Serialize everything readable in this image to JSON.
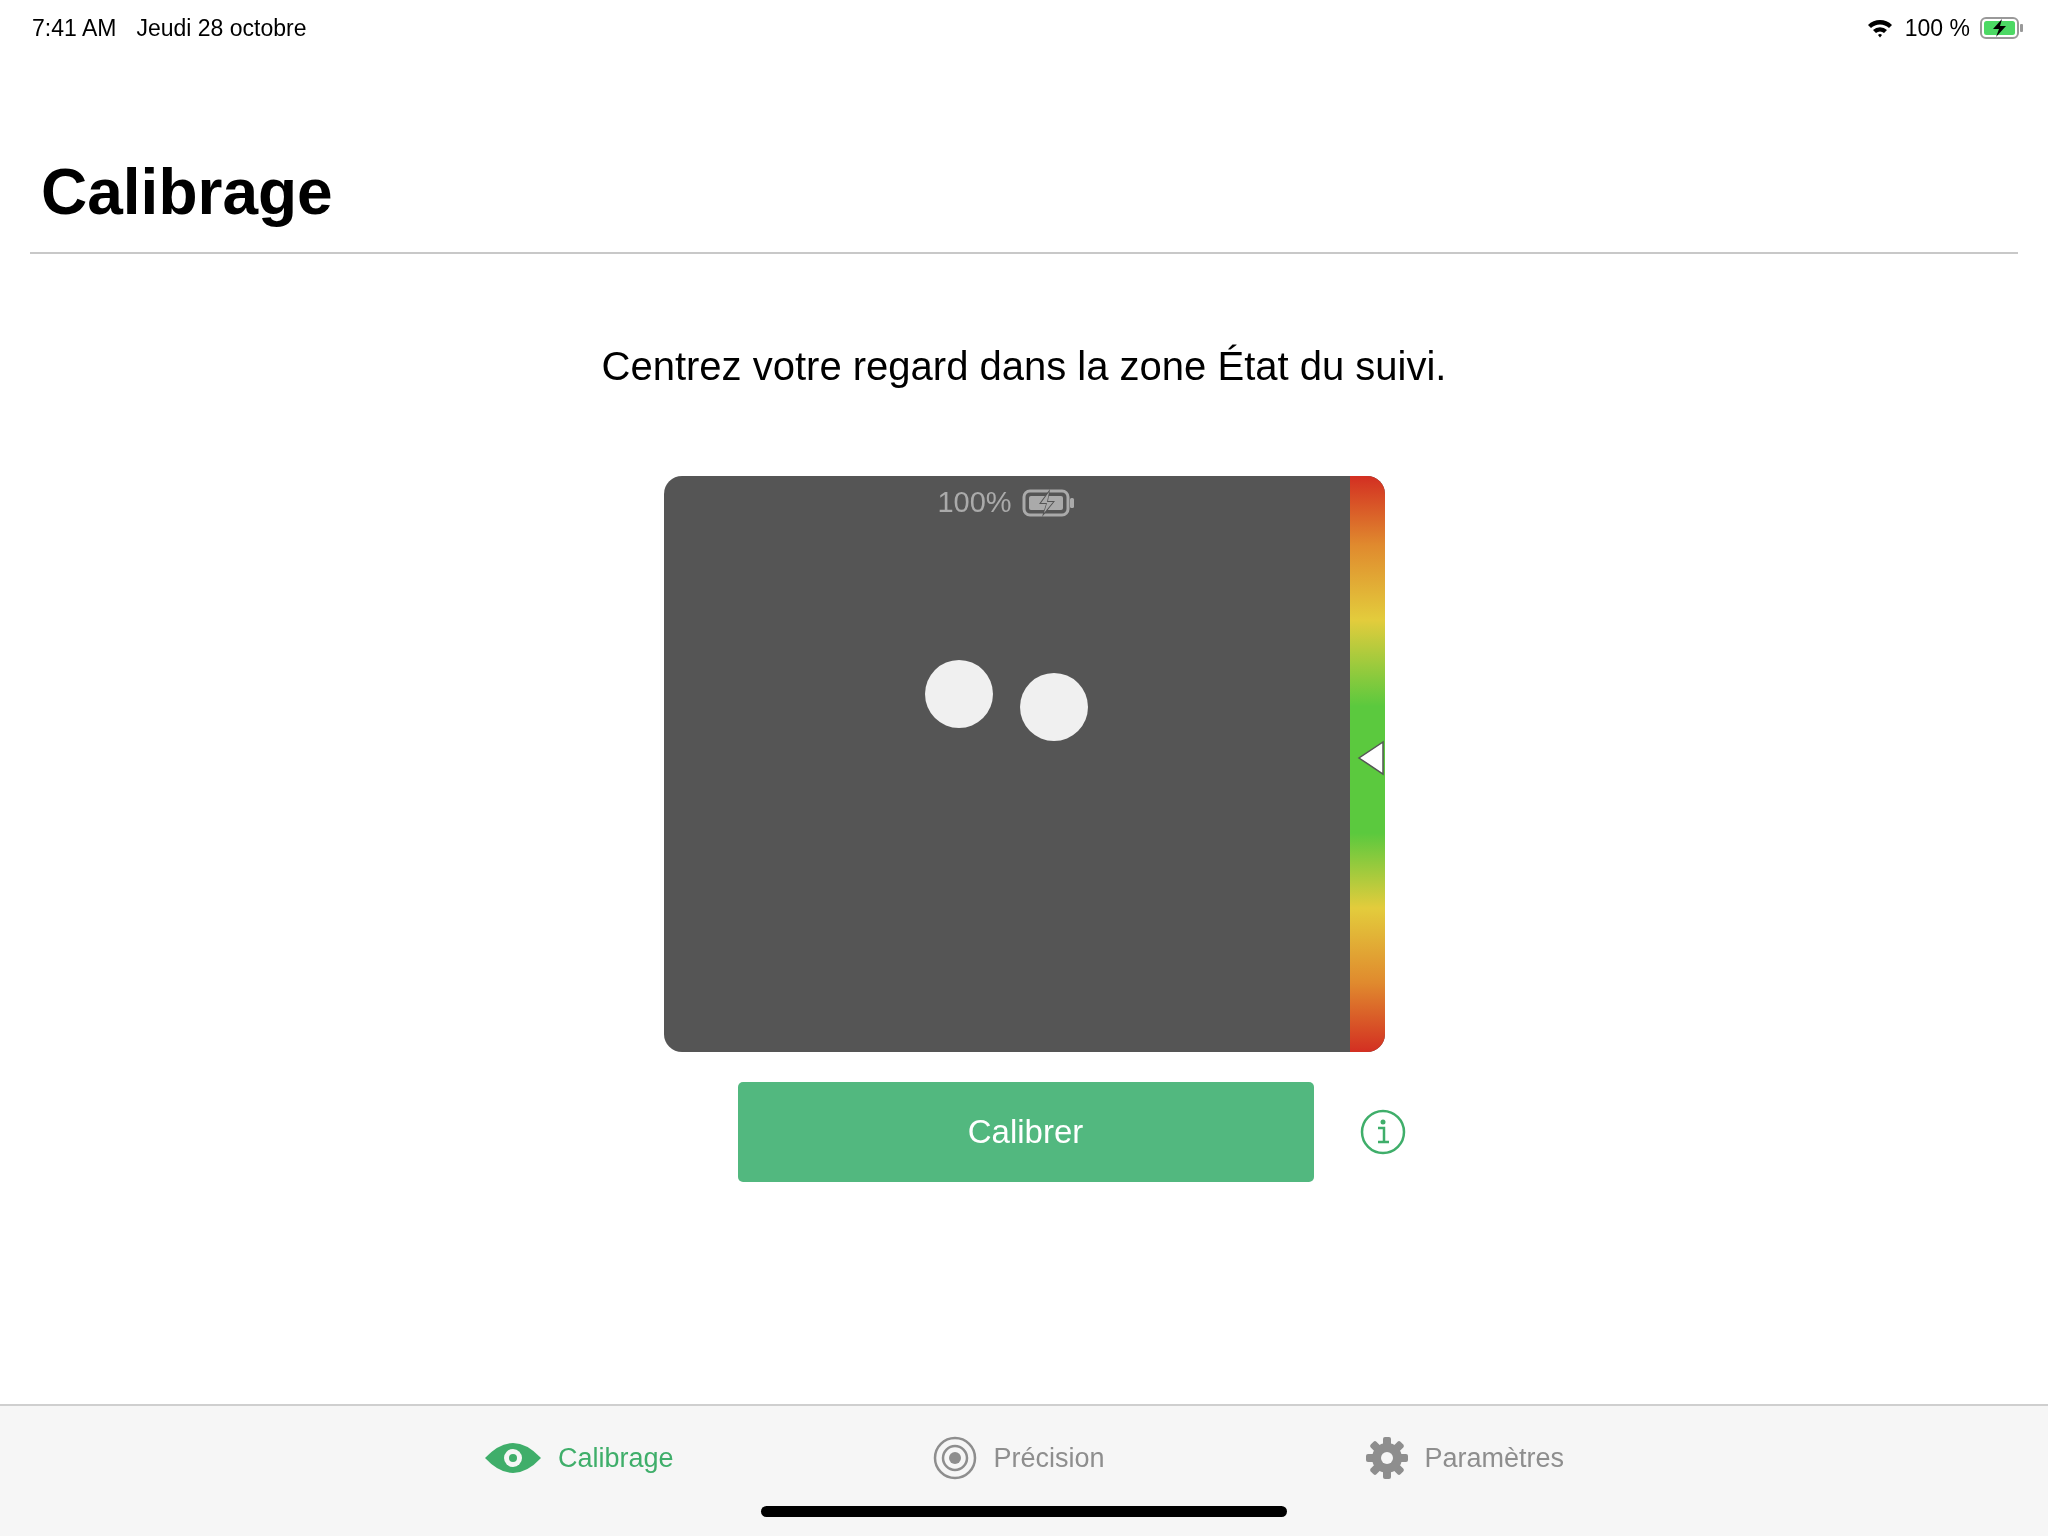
{
  "status_bar": {
    "time": "7:41 AM",
    "date": "Jeudi 28 octobre",
    "battery": "100 %"
  },
  "title": "Calibrage",
  "instruction": "Centrez votre regard dans la zone État du suivi.",
  "tracker": {
    "battery": "100%",
    "distance": {
      "level": 0.49
    }
  },
  "calibrate_button": "Calibrer",
  "tabs": [
    {
      "label": "Calibrage",
      "kind": "eye",
      "selected": true
    },
    {
      "label": "Précision",
      "kind": "target",
      "selected": false
    },
    {
      "label": "Paramètres",
      "kind": "gear",
      "selected": false
    }
  ]
}
